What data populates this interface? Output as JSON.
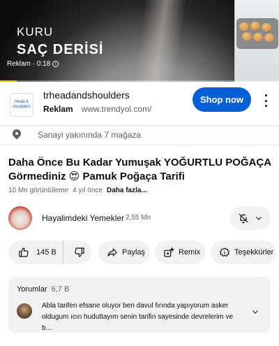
{
  "video_ad": {
    "overlay_line1": "KURU",
    "overlay_line2": "SAÇ DERİSİ",
    "ad_label": "Reklam · 0:18",
    "progress_fraction": 0.06,
    "progress_color": "#fbbc04"
  },
  "ad_card": {
    "advertiser_logo_text": "Head & shoulders",
    "advertiser_name": "trheadandshoulders",
    "ad_tag": "Reklam",
    "ad_url": "www.trendyol.com/",
    "cta_label": "Shop now",
    "cta_color": "#065fd4",
    "more_icon": "kebab-menu-icon",
    "location_icon": "location-pin-icon",
    "location_text": "Sanayi yakınında 7 mağaza"
  },
  "video": {
    "title": "Daha Önce Bu Kadar Yumuşak YOĞURTLU POĞAÇA Görmediniz 😍  Pamuk Poğaça Tarifi",
    "views": "10 Mn görüntüleme",
    "age": "4 yıl önce",
    "more_label": "Daha fazla..."
  },
  "channel": {
    "name": "Hayalimdeki Yemekler",
    "subscribers": "2,55 Mn",
    "bell_icon": "bell-off-icon"
  },
  "actions": {
    "likes": "145 B",
    "share_label": "Paylaş",
    "remix_label": "Remix",
    "thanks_label": "Teşekkürler"
  },
  "comments": {
    "header": "Yorumlar",
    "count": "6,7 B",
    "top_comment": "Abla tarifen efsane oluyor ben davul fırında yapıyorum asker oldugum ıcın huduttayım senin tarifin sayesinde devrelerim ve b..."
  }
}
